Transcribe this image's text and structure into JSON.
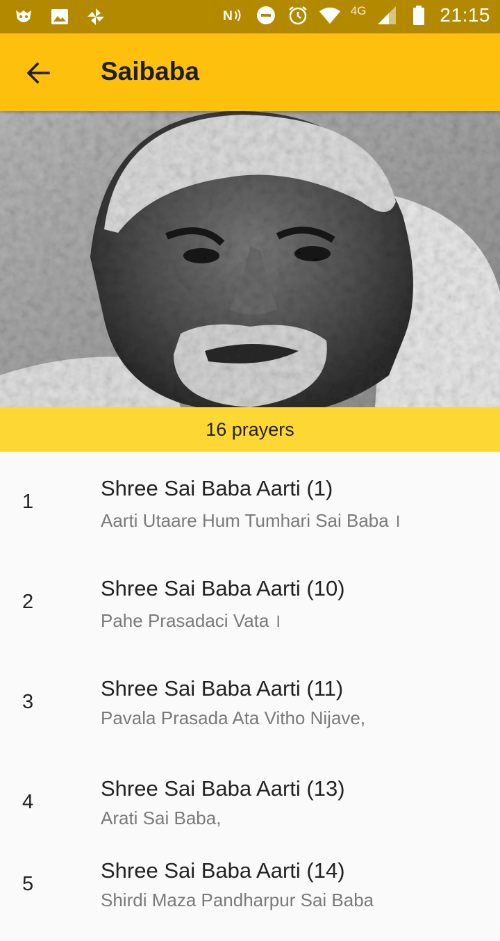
{
  "status_bar": {
    "time": "21:15",
    "network": "4G",
    "left_icons": [
      "app-notification-icon",
      "image-icon",
      "pinwheel-icon"
    ],
    "right_icons": [
      "nfc-icon",
      "do-not-disturb-icon",
      "alarm-icon",
      "wifi-icon",
      "cell-signal-icon",
      "battery-icon"
    ]
  },
  "app_bar": {
    "title": "Saibaba",
    "back_icon": "arrow-back-icon"
  },
  "hero": {
    "alt": "Black and white portrait photo"
  },
  "count_label": "16 prayers",
  "prayers": [
    {
      "num": "1",
      "title": "Shree Sai Baba Aarti (1)",
      "subtitle": "Aarti Utaare Hum Tumhari Sai Baba ।"
    },
    {
      "num": "2",
      "title": "Shree Sai Baba Aarti (10)",
      "subtitle": "Pahe Prasadaci Vata ।"
    },
    {
      "num": "3",
      "title": "Shree Sai Baba Aarti (11)",
      "subtitle": "Pavala Prasada Ata Vitho Nijave,"
    },
    {
      "num": "4",
      "title": "Shree Sai Baba Aarti (13)",
      "subtitle": "Arati Sai Baba,"
    },
    {
      "num": "5",
      "title": "Shree Sai Baba Aarti (14)",
      "subtitle": "Shirdi Maza Pandharpur Sai Baba"
    }
  ],
  "colors": {
    "status_bar": "#b38900",
    "app_bar": "#fdc00c",
    "count_bar": "#fdd835",
    "background": "#fafafa"
  }
}
